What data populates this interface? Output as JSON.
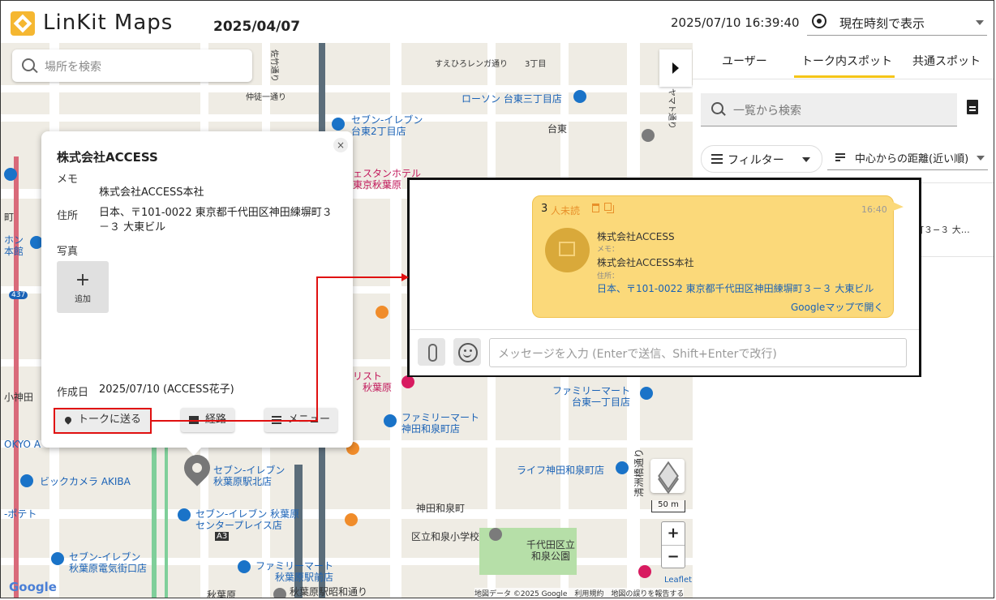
{
  "header": {
    "logo_text": "LinKit Maps",
    "date": "2025/04/07",
    "clock": "2025/07/10 16:39:40",
    "mode_select": "現在時刻で表示"
  },
  "map": {
    "search_placeholder": "場所を検索",
    "scale": "50 m",
    "zoom_in": "+",
    "zoom_out": "−",
    "google": "Google",
    "attribution": "地図データ ©2025 Google　利用規約　地図の誤りを報告する",
    "leaflet": "Leaflet",
    "labels": [
      {
        "text": "すえひろレンガ通り",
        "cls": ""
      },
      {
        "text": "3丁目",
        "cls": ""
      },
      {
        "text": "仲徒一通り",
        "cls": ""
      },
      {
        "text": "ローソン 台東三丁目店",
        "cls": "blue"
      },
      {
        "text": "セブン-イレブン",
        "cls": "blue"
      },
      {
        "text": "台東2丁目店",
        "cls": "blue"
      },
      {
        "text": "台東",
        "cls": ""
      },
      {
        "text": "ェスタンホテル",
        "cls": "pink"
      },
      {
        "text": "東京秋葉原",
        "cls": "pink"
      },
      {
        "text": "リスト",
        "cls": "pink"
      },
      {
        "text": "秋葉原",
        "cls": "pink"
      },
      {
        "text": "ファミリーマート",
        "cls": "blue"
      },
      {
        "text": "台東一丁目店",
        "cls": "blue"
      },
      {
        "text": "ファミリーマート",
        "cls": "blue"
      },
      {
        "text": "神田和泉町店",
        "cls": "blue"
      },
      {
        "text": "ライフ神田和泉町店",
        "cls": "blue"
      },
      {
        "text": "セブン-イレブン",
        "cls": "blue"
      },
      {
        "text": "秋葉原駅北店",
        "cls": "blue"
      },
      {
        "text": "ビックカメラ AKIBA",
        "cls": "blue"
      },
      {
        "text": "神田和泉町",
        "cls": ""
      },
      {
        "text": "セブン-イレブン 秋葉原",
        "cls": "blue"
      },
      {
        "text": "センタープレイス店",
        "cls": "blue"
      },
      {
        "text": "区立和泉小学校",
        "cls": ""
      },
      {
        "text": "千代田区立",
        "cls": ""
      },
      {
        "text": "和泉公園",
        "cls": ""
      },
      {
        "text": "セブン-イレブン",
        "cls": "blue"
      },
      {
        "text": "秋葉原電気街口店",
        "cls": "blue"
      },
      {
        "text": "ファミリーマート",
        "cls": "blue"
      },
      {
        "text": "秋葉原駅前店",
        "cls": "blue"
      },
      {
        "text": "秋葉原駅昭和通り",
        "cls": ""
      },
      {
        "text": "秋葉原",
        "cls": ""
      },
      {
        "text": "清洲橋通り",
        "cls": ""
      },
      {
        "text": "A3",
        "cls": ""
      },
      {
        "text": "437",
        "cls": ""
      },
      {
        "text": "ホン",
        "cls": "blue"
      },
      {
        "text": "本館",
        "cls": "blue"
      },
      {
        "text": "町",
        "cls": ""
      },
      {
        "text": "小神田",
        "cls": ""
      },
      {
        "text": "OKYO A",
        "cls": "blue"
      },
      {
        "text": "-ポテト",
        "cls": "blue"
      },
      {
        "text": "佐竹通り",
        "cls": ""
      },
      {
        "text": "ヤマト通り",
        "cls": ""
      }
    ]
  },
  "popup": {
    "close": "×",
    "title": "株式会社ACCESS",
    "memo_label": "メモ",
    "memo_value": "株式会社ACCESS本社",
    "address_label": "住所",
    "address_value": "日本、〒101-0022 東京都千代田区神田練塀町３－３ 大東ビル",
    "photo_label": "写真",
    "add_photo_plus": "+",
    "add_photo_label": "追加",
    "created_label": "作成日",
    "created_value": "2025/07/10 (ACCESS花子)",
    "send_button": "トークに送る",
    "route_button": "経路",
    "menu_button": "メニュー"
  },
  "panel": {
    "tabs": [
      "ユーザー",
      "トーク内スポット",
      "共通スポット"
    ],
    "search_placeholder": "一覧から検索",
    "filter_label": "フィルター",
    "sort_label": "中心からの距離(近い順)",
    "list_item_snippet": "町３−３ 大…"
  },
  "chat": {
    "count": "3",
    "unread": "人未読",
    "time": "16:40",
    "name": "株式会社ACCESS",
    "memo_label": "メモ：",
    "memo": "株式会社ACCESS本社",
    "address_label": "住所：",
    "address": "日本、〒101-0022 東京都千代田区神田練塀町３－３ 大東ビル",
    "link": "Googleマップで開く",
    "input_placeholder": "メッセージを入力 (Enterで送信、Shift+Enterで改行)"
  },
  "colors": {
    "accent": "#f5c518",
    "bubble": "#fbd97a",
    "annotation": "#e01010",
    "link": "#1a62b6"
  }
}
